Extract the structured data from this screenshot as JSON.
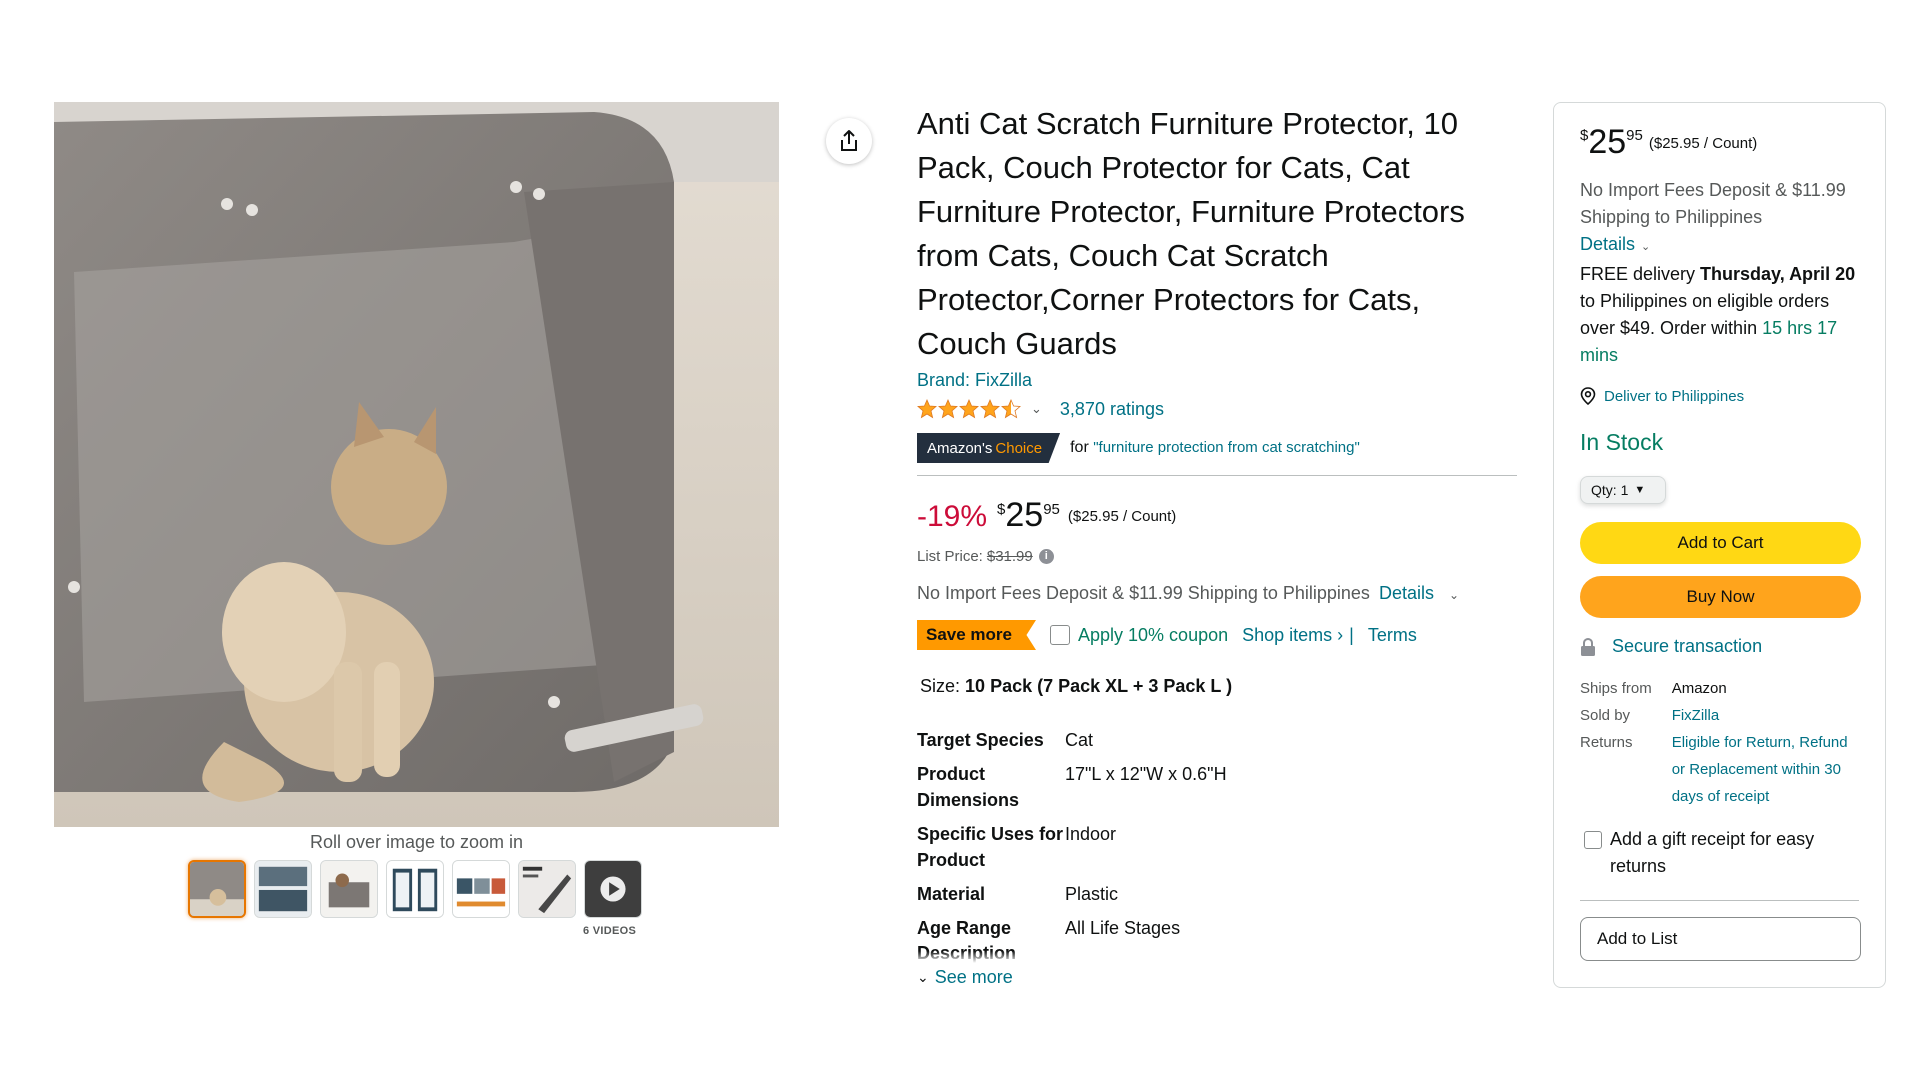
{
  "gallery": {
    "zoom_hint": "Roll over image to zoom in",
    "videos_label": "6 VIDEOS",
    "thumbnail_count": 7,
    "selected_thumbnail": 1
  },
  "product": {
    "title": "Anti Cat Scratch Furniture Protector, 10 Pack, Couch Protector for Cats, Cat Furniture Protector, Furniture Protectors from Cats, Couch Cat Scratch Protector,Corner Protectors for Cats, Couch Guards",
    "brand": "Brand: FixZilla",
    "rating": 4.5,
    "ratings_count": "3,870 ratings",
    "choice_badge_a": "Amazon's",
    "choice_badge_b": "Choice",
    "choice_for": "for",
    "choice_keyword": "\"furniture protection from cat scratching\"",
    "discount": "-19%",
    "price_symbol": "$",
    "price_whole": "25",
    "price_fraction": "95",
    "price_per_unit": "($25.95 / Count)",
    "list_price_label": "List Price:",
    "list_price": "$31.99",
    "shipping": "No Import Fees Deposit & $11.99 Shipping to Philippines",
    "shipping_details": "Details",
    "save_more": "Save more",
    "coupon": "Apply 10% coupon",
    "shop_items": "Shop items ›",
    "separator": "|",
    "terms": "Terms",
    "size_label": "Size:",
    "size_value": "10 Pack (7 Pack XL + 3 Pack L )",
    "specs": [
      {
        "key": "Target Species",
        "value": "Cat"
      },
      {
        "key": "Product Dimensions",
        "value": "17\"L x 12\"W x 0.6\"H"
      },
      {
        "key": "Specific Uses for Product",
        "value": "Indoor"
      },
      {
        "key": "Material",
        "value": "Plastic"
      },
      {
        "key": "Age Range",
        "value": "All Life Stages"
      }
    ],
    "description_cut": "Description",
    "see_more": "See more"
  },
  "buybox": {
    "price_symbol": "$",
    "price_whole": "25",
    "price_fraction": "95",
    "price_per_unit": "($25.95 / Count)",
    "shipping": "No Import Fees Deposit & $11.99 Shipping to Philippines",
    "shipping_details": "Details",
    "delivery_prefix": "FREE delivery",
    "delivery_date": "Thursday, April 20",
    "delivery_suffix": "to Philippines on eligible orders over $49. Order within",
    "delivery_countdown": "15 hrs 17 mins",
    "deliver_to": "Deliver to Philippines",
    "stock": "In Stock",
    "qty_label": "Qty:",
    "qty_value": "1",
    "add_to_cart": "Add to Cart",
    "buy_now": "Buy Now",
    "secure": "Secure transaction",
    "ships_from_label": "Ships from",
    "ships_from": "Amazon",
    "sold_by_label": "Sold by",
    "sold_by": "FixZilla",
    "returns_label": "Returns",
    "returns": "Eligible for Return, Refund or Replacement within 30 days of receipt",
    "gift": "Add a gift receipt for easy returns",
    "add_to_list": "Add to List"
  },
  "colors": {
    "link": "#007185",
    "deal_red": "#cc0c39",
    "stock_green": "#067d62",
    "cart_yellow": "#ffd814",
    "buy_orange": "#ffa41c",
    "star": "#ffa41c",
    "badge_dark": "#232f3e"
  }
}
